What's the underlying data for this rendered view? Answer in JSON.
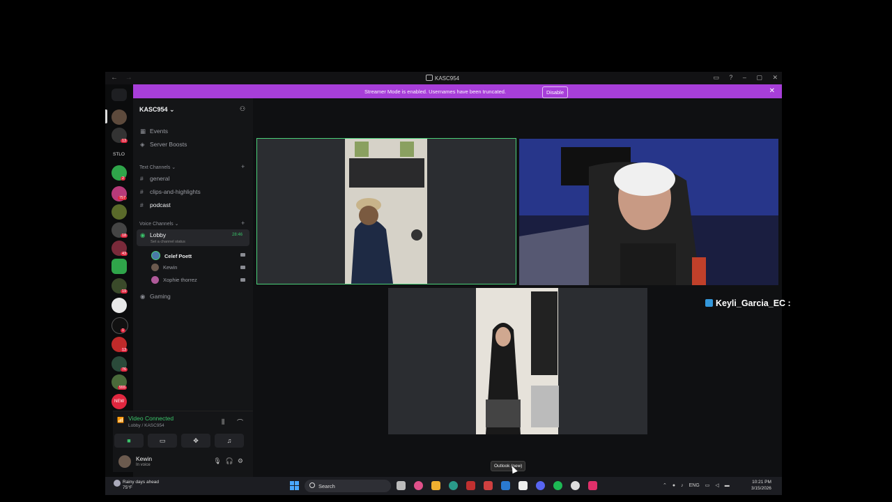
{
  "window": {
    "title": "KASC954",
    "nav_back": "←",
    "nav_forward": "→",
    "controls": [
      "▭",
      "?",
      "–",
      "▢",
      "✕"
    ]
  },
  "banner": {
    "text": "Streamer Mode is enabled. Usernames have been truncated.",
    "button": "Disable",
    "close": "✕"
  },
  "rail": {
    "label": "STLO",
    "badges": [
      "3",
      "13",
      "2",
      "757",
      "3",
      "18",
      "43",
      "19",
      "1",
      "13",
      "76",
      "555"
    ],
    "new_badge": "NEW"
  },
  "server": {
    "name": "KASC954",
    "chevron": "⌄",
    "events": "Events",
    "boosts": "Server Boosts",
    "text_category": "Text Channels",
    "text_channels": [
      "general",
      "clips-and-highlights",
      "podcast"
    ],
    "voice_category": "Voice Channels",
    "lobby": {
      "name": "Lobby",
      "timer": "28:46",
      "status_placeholder": "Set a channel status"
    },
    "voice_users": [
      {
        "name": "Celef Poett",
        "color": "#4a7aa8"
      },
      {
        "name": "Kewin",
        "color": "#6b5a4e"
      },
      {
        "name": "Xophie thorrez",
        "color": "#b05a9a"
      }
    ],
    "gaming": "Gaming"
  },
  "voice_panel": {
    "status": "Video Connected",
    "location": "Lobby / KASC954",
    "buttons": [
      "camera-icon",
      "screen-share-icon",
      "activities-icon",
      "soundboard-icon"
    ]
  },
  "user": {
    "name": "Kewin",
    "status": "In voice"
  },
  "overlay": {
    "username": "Keyli_Garcia_EC :"
  },
  "tooltip": "Outlook (new)",
  "taskbar": {
    "weather_line1": "Rainy days ahead",
    "weather_line2": "75°F",
    "search_placeholder": "Search",
    "lang": "ENG",
    "time": "10:21 PM",
    "date": "3/15/2026"
  },
  "colors": {
    "banner": "#a73ed9",
    "speaking": "#4bd17a",
    "connected": "#3ac46a"
  }
}
